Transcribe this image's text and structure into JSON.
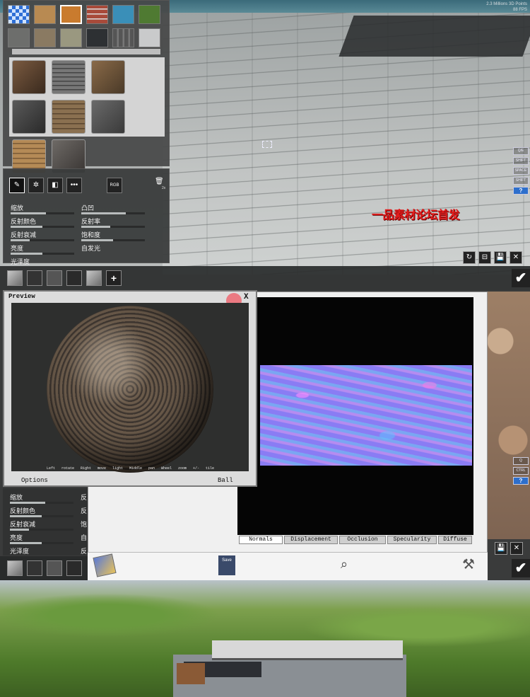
{
  "top": {
    "meta_line1": "",
    "meta_line2": "2.3 Millions 3D Points",
    "meta_line3": "88 FPS",
    "side_buttons": [
      "Q/E",
      "SHIFT",
      "SPACE",
      "SHIFT",
      "?"
    ],
    "watermark": "一品素材论坛首发",
    "tools": [
      "✎",
      "✲",
      "◧",
      "•••"
    ],
    "rgb_label": "RGB",
    "trash_count": "2x",
    "params_left": [
      {
        "label": "缩放",
        "level": 0.55
      },
      {
        "label": "反射颜色",
        "level": 0.5
      },
      {
        "label": "反射衰减",
        "level": 0.3
      },
      {
        "label": "亮度",
        "level": 0.5
      },
      {
        "label": "光泽度",
        "level": 0.2
      }
    ],
    "params_right": [
      {
        "label": "凸凹",
        "level": 0.7
      },
      {
        "label": "反射率",
        "level": 0.45
      },
      {
        "label": "饱和度",
        "level": 0.5
      },
      {
        "label": "自发光",
        "level": 0.0
      }
    ],
    "bottom_right_buttons": [
      "↻",
      "⊟",
      "💾",
      "✕"
    ],
    "confirm": "✔",
    "add": "+"
  },
  "preview": {
    "title": "Preview",
    "close": "X",
    "hints": "Left rotate Right move light Middle pan Wheel zoom +/- tile",
    "options": "Options",
    "mode": "Ball"
  },
  "texture": {
    "tabs": [
      "Normals",
      "Displacement",
      "Occlusion",
      "Specularity",
      "Diffuse"
    ],
    "active_tab": "Normals",
    "save_label": "Save",
    "mid_side_buttons": [
      "Q",
      "CTRL",
      "?"
    ]
  },
  "mid_params": {
    "left": [
      "缩放",
      "反射颜色",
      "反射衰减",
      "亮度",
      "光泽度"
    ],
    "right_partial": [
      "反",
      "反",
      "饱",
      "自",
      "反"
    ]
  },
  "colors": {
    "watermark": "#e41d1d",
    "help_blue": "#2d6fcc",
    "normal_map": "#8e86ee"
  }
}
